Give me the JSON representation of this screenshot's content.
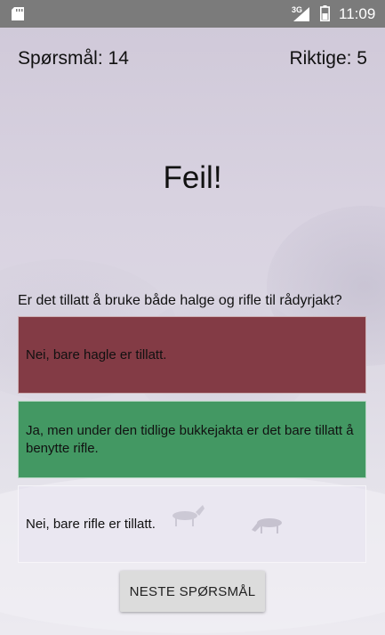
{
  "status_bar": {
    "network": "3G",
    "time": "11:09",
    "icons": [
      "sd-card-icon",
      "signal-icon",
      "battery-icon"
    ]
  },
  "quiz": {
    "question_counter": "Spørsmål: 14",
    "correct_counter": "Riktige: 5",
    "result": "Feil!",
    "question": "Er det tillatt å bruke både halge og rifle til rådyrjakt?",
    "answers": [
      {
        "text": "Nei, bare hagle er tillatt.",
        "state": "selected-wrong",
        "color": "#833b45"
      },
      {
        "text": "Ja, men under den tidlige bukkejakta er det bare tillatt å benytte rifle.",
        "state": "correct",
        "color": "#439863"
      },
      {
        "text": "Nei, bare rifle er tillatt.",
        "state": "neutral"
      }
    ],
    "next_button": "NESTE SPØRSMÅL"
  }
}
